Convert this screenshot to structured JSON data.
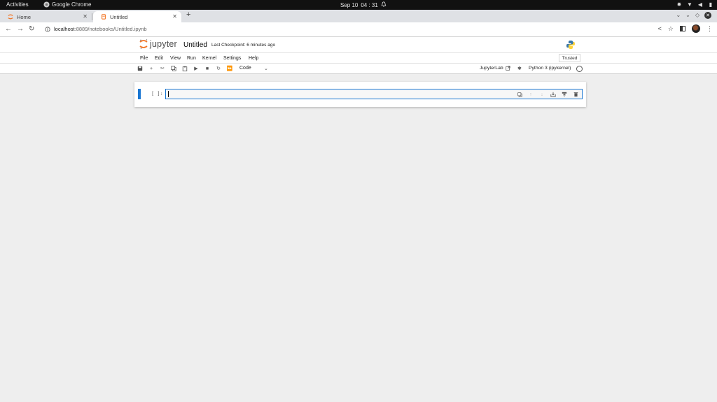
{
  "os_topbar": {
    "activities": "Activities",
    "app_name": "Google Chrome",
    "date": "Sep 10",
    "time": "04 : 31"
  },
  "browser": {
    "tabs": [
      {
        "title": "Home",
        "active": false
      },
      {
        "title": "Untitled",
        "active": true
      }
    ],
    "url_host": "localhost",
    "url_path": ":8889/notebooks/Untitled.ipynb"
  },
  "jupyter": {
    "logo_text": "jupyter",
    "notebook_name": "Untitled",
    "checkpoint": "Last Checkpoint: 6 minutes ago",
    "trusted": "Trusted",
    "menu": [
      "File",
      "Edit",
      "View",
      "Run",
      "Kernel",
      "Settings",
      "Help"
    ],
    "cell_type": "Code",
    "jupyterlab_link": "JupyterLab",
    "kernel_name": "Python 3 (ipykernel)",
    "cell_prompt": "[ ]:"
  },
  "colors": {
    "accent": "#1976d2",
    "jupyter_orange": "#f37626",
    "page_bg": "#eeeeee"
  }
}
